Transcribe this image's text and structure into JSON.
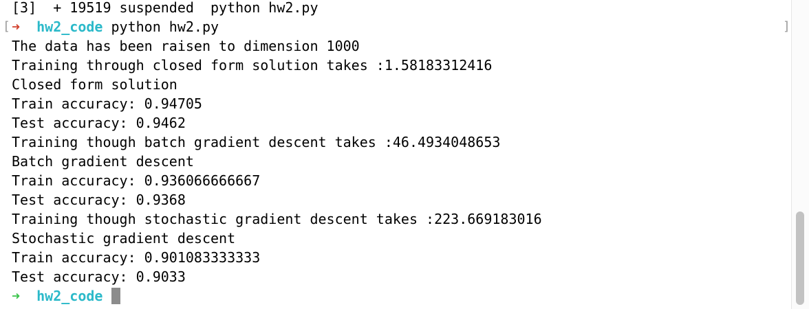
{
  "terminal": {
    "job_line": "[3]  + 19519 suspended  python hw2.py",
    "prompt1": {
      "arrow": "➜",
      "dir": "hw2_code",
      "command": "python hw2.py"
    },
    "output": [
      "The data has been raisen to dimension 1000",
      "Training through closed form solution takes :1.58183312416",
      "Closed form solution",
      "Train accuracy: 0.94705",
      "Test accuracy: 0.9462",
      "Training though batch gradient descent takes :46.4934048653",
      "Batch gradient descent",
      "Train accuracy: 0.936066666667",
      "Test accuracy: 0.9368",
      "Training though stochastic gradient descent takes :223.669183016",
      "Stochastic gradient descent",
      "Train accuracy: 0.901083333333",
      "Test accuracy: 0.9033"
    ],
    "prompt2": {
      "arrow": "➜",
      "dir": "hw2_code"
    },
    "bracket_left": "[",
    "bracket_right": "]"
  },
  "colors": {
    "prompt_arrow": "#39c349",
    "prompt_arrow_error": "#d2412d",
    "prompt_dir": "#2bb9c9",
    "cursor": "#8c8c8c"
  }
}
